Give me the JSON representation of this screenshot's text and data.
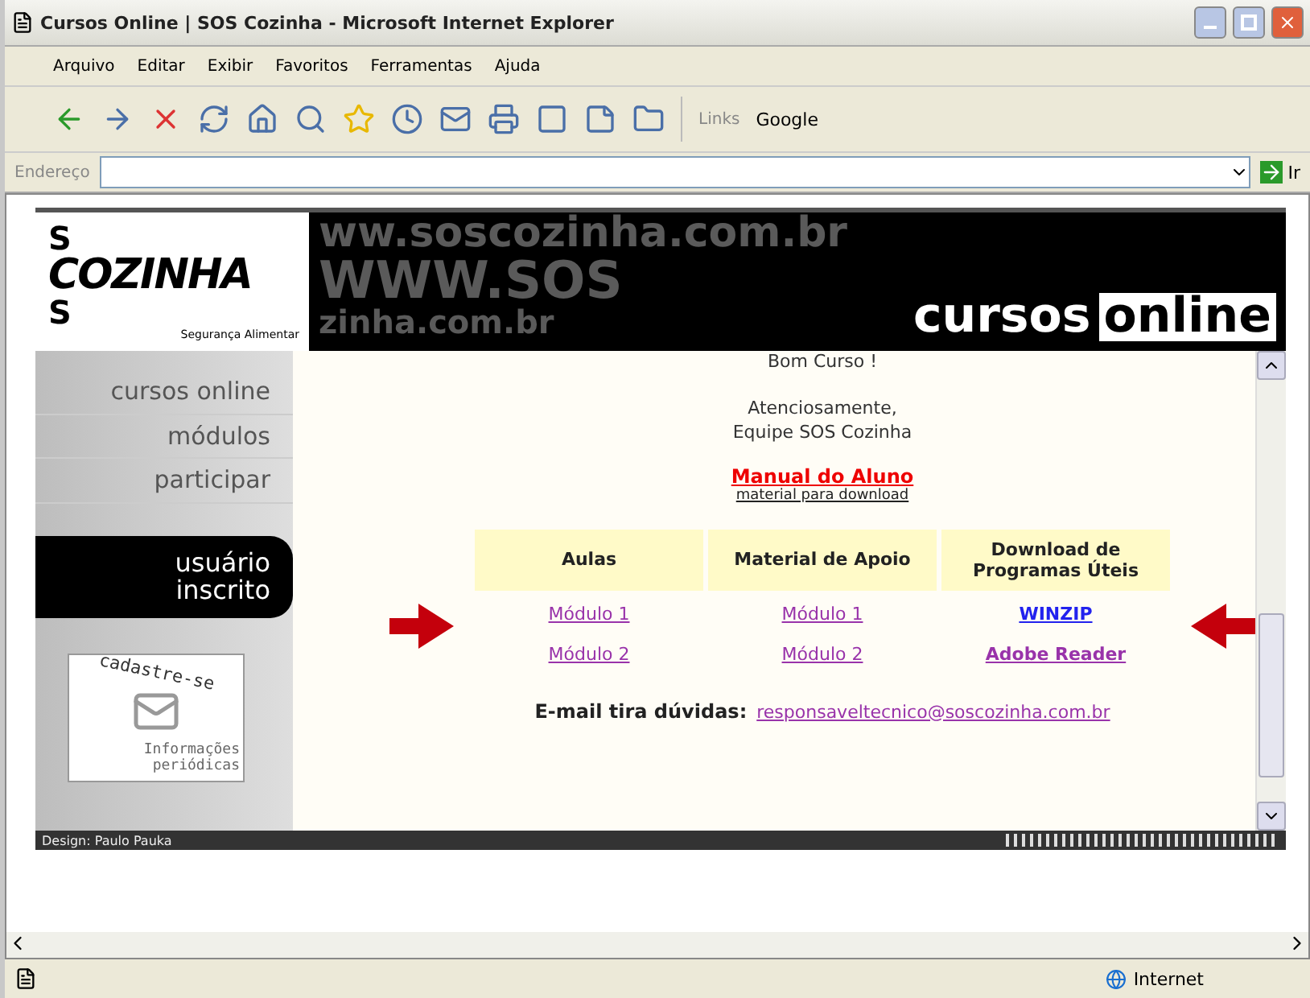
{
  "window": {
    "title": "Cursos Online | SOS Cozinha - Microsoft Internet Explorer"
  },
  "menu": [
    "Arquivo",
    "Editar",
    "Exibir",
    "Favoritos",
    "Ferramentas",
    "Ajuda"
  ],
  "toolbar": {
    "links_label": "Links",
    "links": [
      "Google"
    ]
  },
  "address": {
    "label": "Endereço",
    "go": "Ir"
  },
  "site": {
    "logo": {
      "marks": [
        "S",
        "S"
      ],
      "title": "COZINHA",
      "tagline": "Segurança Alimentar"
    },
    "banner": [
      "ww.soscozinha.com.br",
      "WWW.SOS",
      "zinha.com.br"
    ],
    "brand": [
      "cursos",
      "online"
    ],
    "nav": [
      {
        "label": "cursos online",
        "selected": false
      },
      {
        "label": "módulos",
        "selected": false
      },
      {
        "label": "participar",
        "selected": false
      },
      {
        "label": "usuário inscrito",
        "selected": true
      }
    ],
    "signup": {
      "title": "cadastre-se",
      "subtitle": "Informações periódicas"
    },
    "content": {
      "greeting": "Bom Curso !",
      "closing": [
        "Atenciosamente,",
        "Equipe SOS Cozinha"
      ],
      "manual": {
        "title": "Manual do Aluno",
        "subtitle": "material para download"
      },
      "table": {
        "columns": [
          "Aulas",
          "Material de Apoio",
          "Download de Programas Úteis"
        ],
        "rows": [
          [
            {
              "text": "Módulo 1",
              "visited": true
            },
            {
              "text": "Módulo 1",
              "visited": true
            },
            {
              "text": "WINZIP",
              "visited": false
            }
          ],
          [
            {
              "text": "Módulo 2",
              "visited": true
            },
            {
              "text": "Módulo 2",
              "visited": true
            },
            {
              "text": "Adobe Reader",
              "visited": true
            }
          ]
        ]
      },
      "email": {
        "label": "E-mail tira dúvidas:",
        "value": "responsaveltecnico@soscozinha.com.br"
      }
    },
    "footer": {
      "credit": "Design: Paulo Pauka"
    }
  },
  "status": {
    "zone": "Internet"
  }
}
